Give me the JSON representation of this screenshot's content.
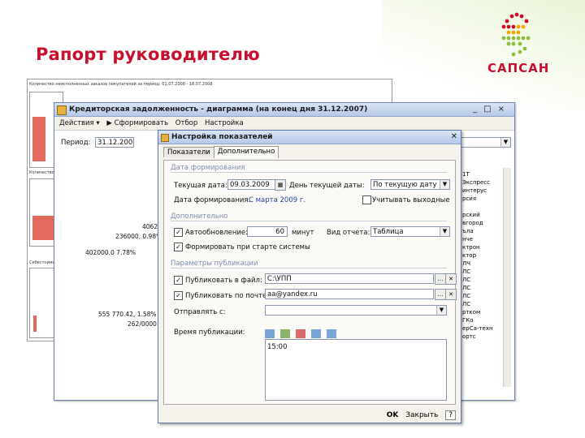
{
  "slide": {
    "title": "Рапорт руководителю"
  },
  "logo": {
    "text": "САПСАН"
  },
  "bg_report": {
    "hdr1": "Количество неисполненных заказов покупателей за период: 01.07.2008 - 18.07.2008",
    "hdr2": "Количество действ...",
    "hdr3": "Себестоимость...",
    "sales": [
      "4062522",
      "236000, 0.98%",
      "402000.0 7.78%",
      "555 770.42, 1.58%",
      "262/0000"
    ],
    "right_list": [
      "1Т",
      "Экспресс",
      "интерус",
      "рсия",
      "",
      "рский",
      "вгород",
      "ъла",
      "нчe",
      "ктрон",
      "ктор",
      "ЛЧ",
      "ЛС",
      "ЛС",
      "ЛС",
      "ЛС",
      "ЛС",
      "ртком",
      "ГКо",
      "ерСа-техн",
      "ортс"
    ]
  },
  "report_window": {
    "title": "Кредиторская задолженность - диаграмма (на конец дня 31.12.2007)",
    "toolbar": [
      "Действия ▾",
      "▶ Сформировать",
      "Отбор",
      "Настройка"
    ],
    "period_label": "Период:",
    "period_value": "31.12.2007"
  },
  "dialog": {
    "title": "Настройка показателей",
    "tabs": [
      "Показатели",
      "Дополнительно"
    ],
    "sec_date": "Дата формирования",
    "cur_date_label": "Текущая дата:",
    "cur_date_value": "09.03.2009",
    "day_label": "День текущей даты:",
    "day_value": "По текущую дату",
    "gen_date_label": "Дата формирования:",
    "gen_date_value": "С марта 2009 г.",
    "weekend_label": "Учитывать выходные",
    "sec_extra": "Дополнительно",
    "autosave_label": "Автообновление:",
    "autosave_value": "60",
    "autosave_unit": "минут",
    "report_type_label": "Вид отчета:",
    "report_type_value": "Таблица",
    "startup_label": "Формировать при старте системы",
    "sec_publish": "Параметры публикации",
    "to_file_label": "Публиковать в файл:",
    "to_file_value": "C:\\УПП",
    "to_mail_label": "Публиковать по почте:",
    "to_mail_value": "aa@yandex.ru",
    "send_from_label": "Отправлять с:",
    "send_from_value": "",
    "pub_time_label": "Время публикации:",
    "pub_time_value": "15:00",
    "ok_label": "OK",
    "close_label": "Закрыть",
    "help_label": "?"
  }
}
